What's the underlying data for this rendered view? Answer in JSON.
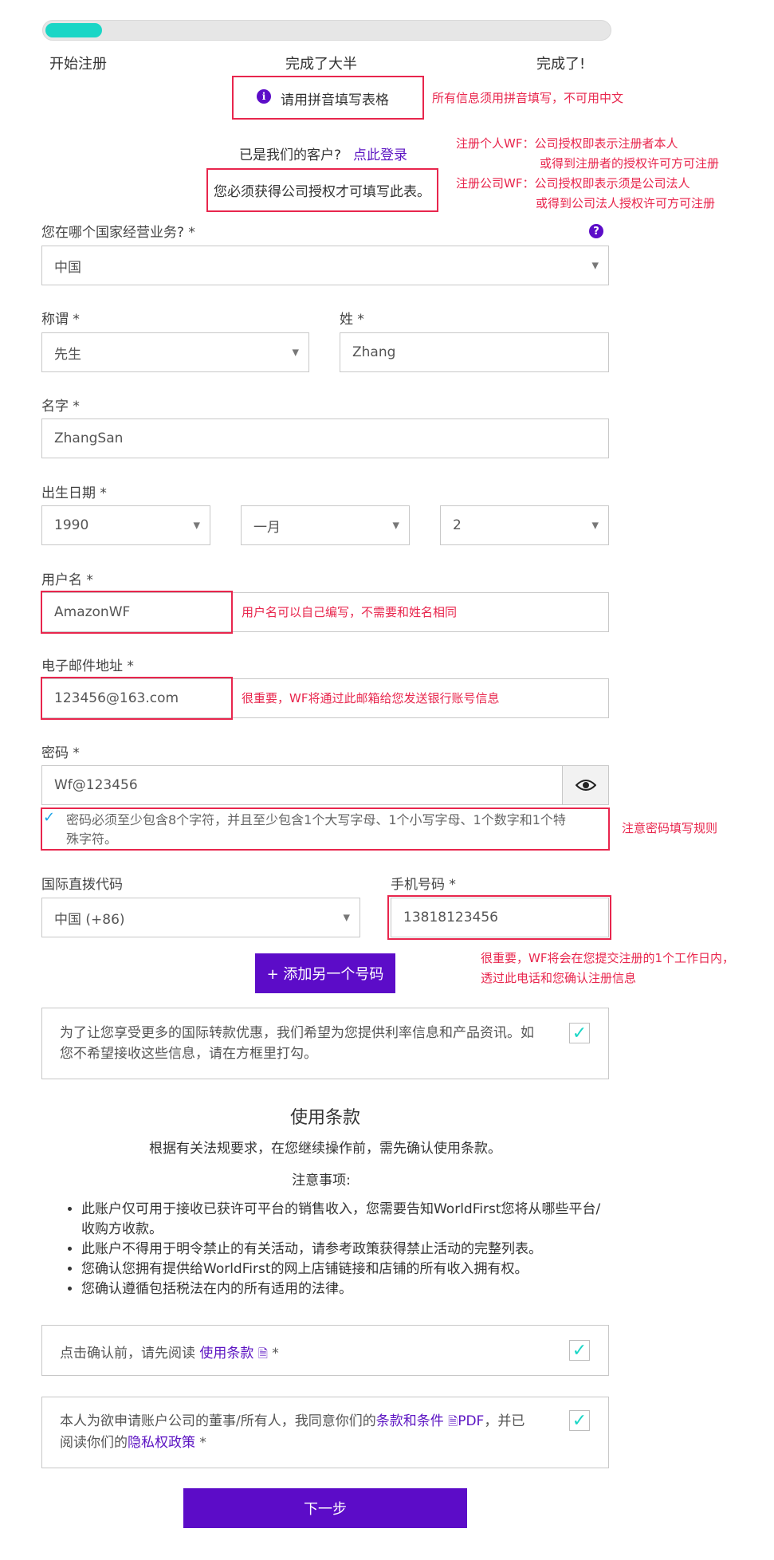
{
  "progress": {
    "fill_fraction": 0.1,
    "steps": [
      "开始注册",
      "完成了大半",
      "完成了!"
    ]
  },
  "notices": {
    "pinyin": "请用拼音填写表格",
    "pinyin_note": "所有信息须用拼音填写，不可用中文",
    "existing_customer": "已是我们的客户?",
    "login_link": "点此登录",
    "authorization": "您必须获得公司授权才可填写此表。",
    "auth_note_1": "注册个人WF：公司授权即表示注册者本人",
    "auth_note_2": "或得到注册者的授权许可方可注册",
    "auth_note_3": "注册公司WF：公司授权即表示须是公司法人",
    "auth_note_4": "或得到公司法人授权许可方可注册"
  },
  "form": {
    "country_label": "您在哪个国家经营业务?  *",
    "country_value": "中国",
    "salutation_label": "称谓 *",
    "salutation_value": "先生",
    "surname_label": "姓 *",
    "surname_value": "Zhang",
    "given_name_label": "名字 *",
    "given_name_value": "ZhangSan",
    "dob_label": "出生日期 *",
    "dob_year": "1990",
    "dob_month": "一月",
    "dob_day": "2",
    "username_label": "用户名 *",
    "username_value": "AmazonWF",
    "username_note": "用户名可以自己编写，不需要和姓名相同",
    "email_label": "电子邮件地址 *",
    "email_value": "123456@163.com",
    "email_note": "很重要，WF将通过此邮箱给您发送银行账号信息",
    "password_label": "密码 *",
    "password_value": "Wf@123456",
    "password_rule_1": "密码必须至少包含8个字符，并且至少包含1个大写字母、1个小写字母、1个数字和1个特",
    "password_rule_2": "殊字符。",
    "password_note": "注意密码填写规则",
    "dial_code_label": "国际直拨代码",
    "dial_code_value": "中国 (+86)",
    "phone_label": "手机号码 *",
    "phone_value": "13818123456",
    "add_phone_button": "+ 添加另一个号码",
    "phone_note_1": "很重要，WF将会在您提交注册的1个工作日内，",
    "phone_note_2": "透过此电话和您确认注册信息",
    "marketing_line_1": "为了让您享受更多的国际转款优惠，我们希望为您提供利率信息和产品资讯。如",
    "marketing_line_2": "您不希望接收这些信息，请在方框里打勾。"
  },
  "terms": {
    "title": "使用条款",
    "subtitle": "根据有关法规要求，在您继续操作前，需先确认使用条款。",
    "notes_heading": "注意事项:",
    "notes": [
      "此账户仅可用于接收已获许可平台的销售收入，您需要告知WorldFirst您将从哪些平台/收购方收款。",
      "此账户不得用于明令禁止的有关活动，请参考政策获得禁止活动的完整列表。",
      "您确认您拥有提供给WorldFirst的网上店铺链接和店铺的所有收入拥有权。",
      "您确认遵循包括税法在内的所有适用的法律。"
    ],
    "read_prefix": "点击确认前，请先阅读",
    "read_link": "使用条款",
    "read_suffix": " *",
    "consent_1": "本人为欲申请账户公司的董事/所有人，我同意你们的",
    "consent_link_terms": "条款和条件",
    "consent_pdf": "PDF",
    "consent_2": "，并已",
    "consent_3": "阅读你们的",
    "consent_link_privacy": "隐私权政策",
    "consent_suffix": " *"
  },
  "next_button": "下一步",
  "colors": {
    "accent_purple": "#5c0cc8",
    "teal": "#1ad6c6",
    "annotation_red": "#e8264d"
  }
}
